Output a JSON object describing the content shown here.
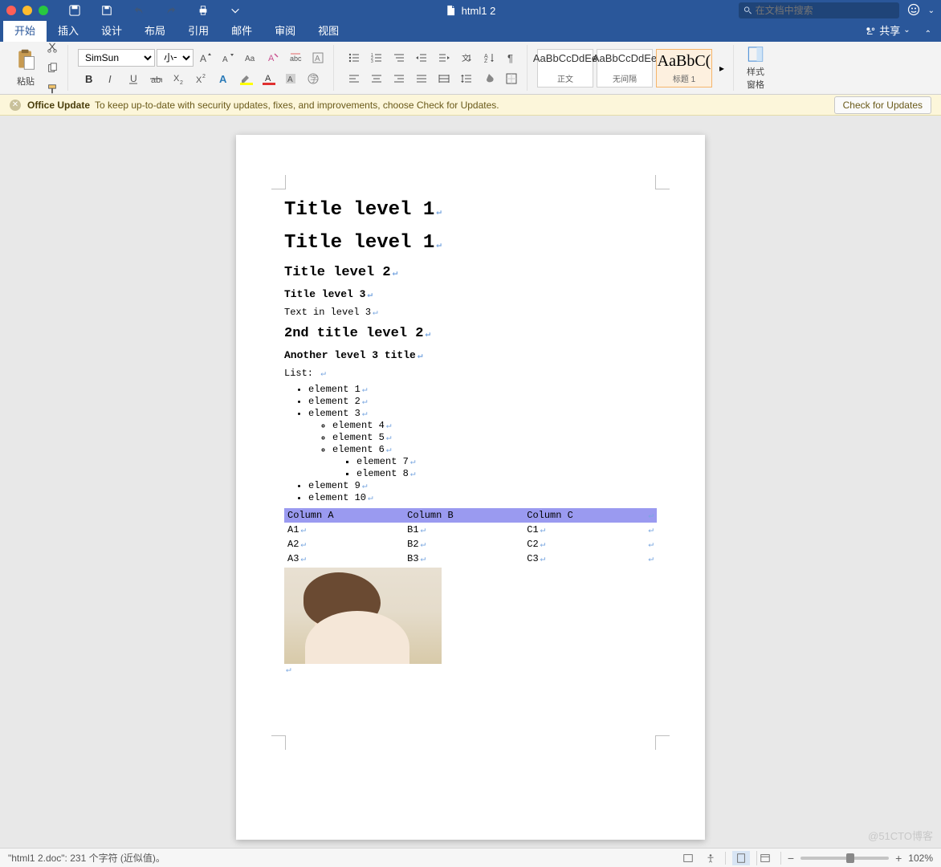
{
  "title": "html1 2",
  "search": {
    "placeholder": "在文档中搜索"
  },
  "tabs": {
    "t0": "开始",
    "t1": "插入",
    "t2": "设计",
    "t3": "布局",
    "t4": "引用",
    "t5": "邮件",
    "t6": "审阅",
    "t7": "视图"
  },
  "share": "共享",
  "ribbon": {
    "paste": "粘贴",
    "font_name": "SimSun",
    "font_size": "小一"
  },
  "styles": {
    "s0": {
      "preview": "AaBbCcDdEe",
      "name": "正文"
    },
    "s1": {
      "preview": "AaBbCcDdEe",
      "name": "无间隔"
    },
    "s2": {
      "preview": "AaBbC(",
      "name": "标题 1"
    }
  },
  "pane": "样式\n窗格",
  "notice": {
    "title": "Office Update",
    "msg": "To keep up-to-date with security updates, fixes, and improvements, choose Check for Updates.",
    "btn": "Check for Updates"
  },
  "doc": {
    "h1a": "Title level 1",
    "h1b": "Title level 1",
    "h2a": "Title level 2",
    "h3a": "Title level 3",
    "p1": "Text in level 3",
    "h2b": "2nd title level 2",
    "h3b": "Another level 3 title",
    "listlabel": "List: ",
    "li1": "element 1",
    "li2": "element 2",
    "li3": "element 3",
    "li4": "element 4",
    "li5": "element 5",
    "li6": "element 6",
    "li7": "element 7",
    "li8": "element 8",
    "li9": "element 9",
    "li10": "element 10",
    "table": {
      "hA": "Column A",
      "hB": "Column B",
      "hC": "Column C",
      "r1": {
        "a": "A1",
        "b": "B1",
        "c": "C1"
      },
      "r2": {
        "a": "A2",
        "b": "B2",
        "c": "C2"
      },
      "r3": {
        "a": "A3",
        "b": "B3",
        "c": "C3"
      }
    }
  },
  "status": {
    "text": "\"html1 2.doc\": 231 个字符 (近似值)。",
    "zoom": "102%"
  },
  "watermark": "@51CTO博客"
}
